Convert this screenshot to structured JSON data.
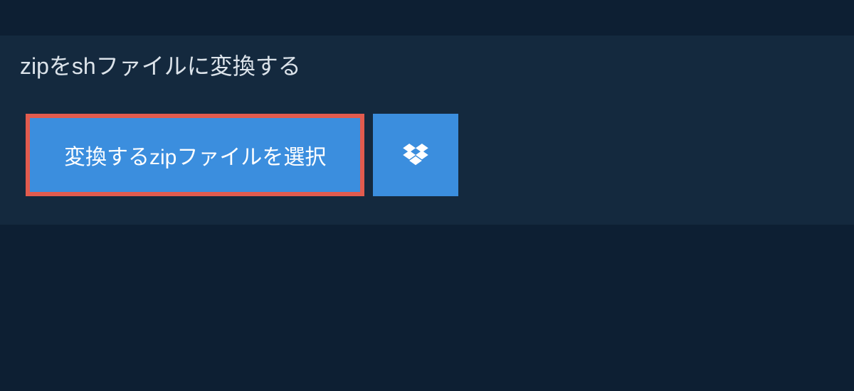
{
  "title": "zipをshファイルに変換する",
  "selectButton": {
    "label": "変換するzipファイルを選択"
  },
  "colors": {
    "pageBg": "#0d1f33",
    "panelBg": "#14293e",
    "buttonBg": "#3b8ede",
    "highlightBorder": "#e25b4e",
    "textLight": "#dce3ea",
    "textWhite": "#ffffff"
  }
}
